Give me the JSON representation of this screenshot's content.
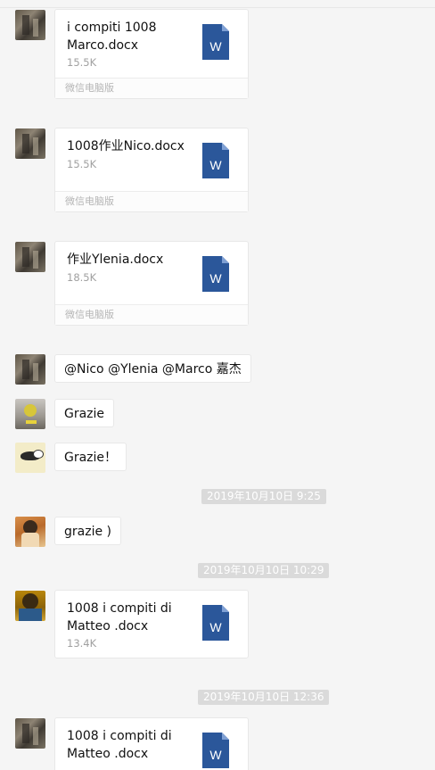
{
  "messages": {
    "m1": {
      "file_name": "i compiti 1008 Marco.docx",
      "file_size": "15.5K",
      "source": "微信电脑版",
      "file_icon": "W"
    },
    "m2": {
      "file_name": "1008作业Nico.docx",
      "file_size": "15.5K",
      "source": "微信电脑版",
      "file_icon": "W"
    },
    "m3": {
      "file_name": "作业Ylenia.docx",
      "file_size": "18.5K",
      "source": "微信电脑版",
      "file_icon": "W"
    },
    "m4": {
      "text": "@Nico @Ylenia @Marco 嘉杰"
    },
    "m5": {
      "text": "Grazie"
    },
    "m6": {
      "text": "Grazie！"
    },
    "t1": {
      "text": "2019年10月10日 9:25"
    },
    "m7": {
      "text": "grazie )"
    },
    "t2": {
      "text": "2019年10月10日 10:29"
    },
    "m8": {
      "file_name": "1008 i compiti di Matteo .docx",
      "file_size": "13.4K",
      "file_icon": "W"
    },
    "t3": {
      "text": "2019年10月10日 12:36"
    },
    "m9": {
      "file_name": "1008 i compiti di Matteo .docx",
      "file_icon": "W"
    }
  },
  "colors": {
    "word_blue": "#2b579a",
    "word_fold": "#7fa0d4",
    "timestamp_bg": "#dadada",
    "chat_bg": "#f5f5f5"
  },
  "icons": {
    "file_type": "word-doc-icon"
  }
}
